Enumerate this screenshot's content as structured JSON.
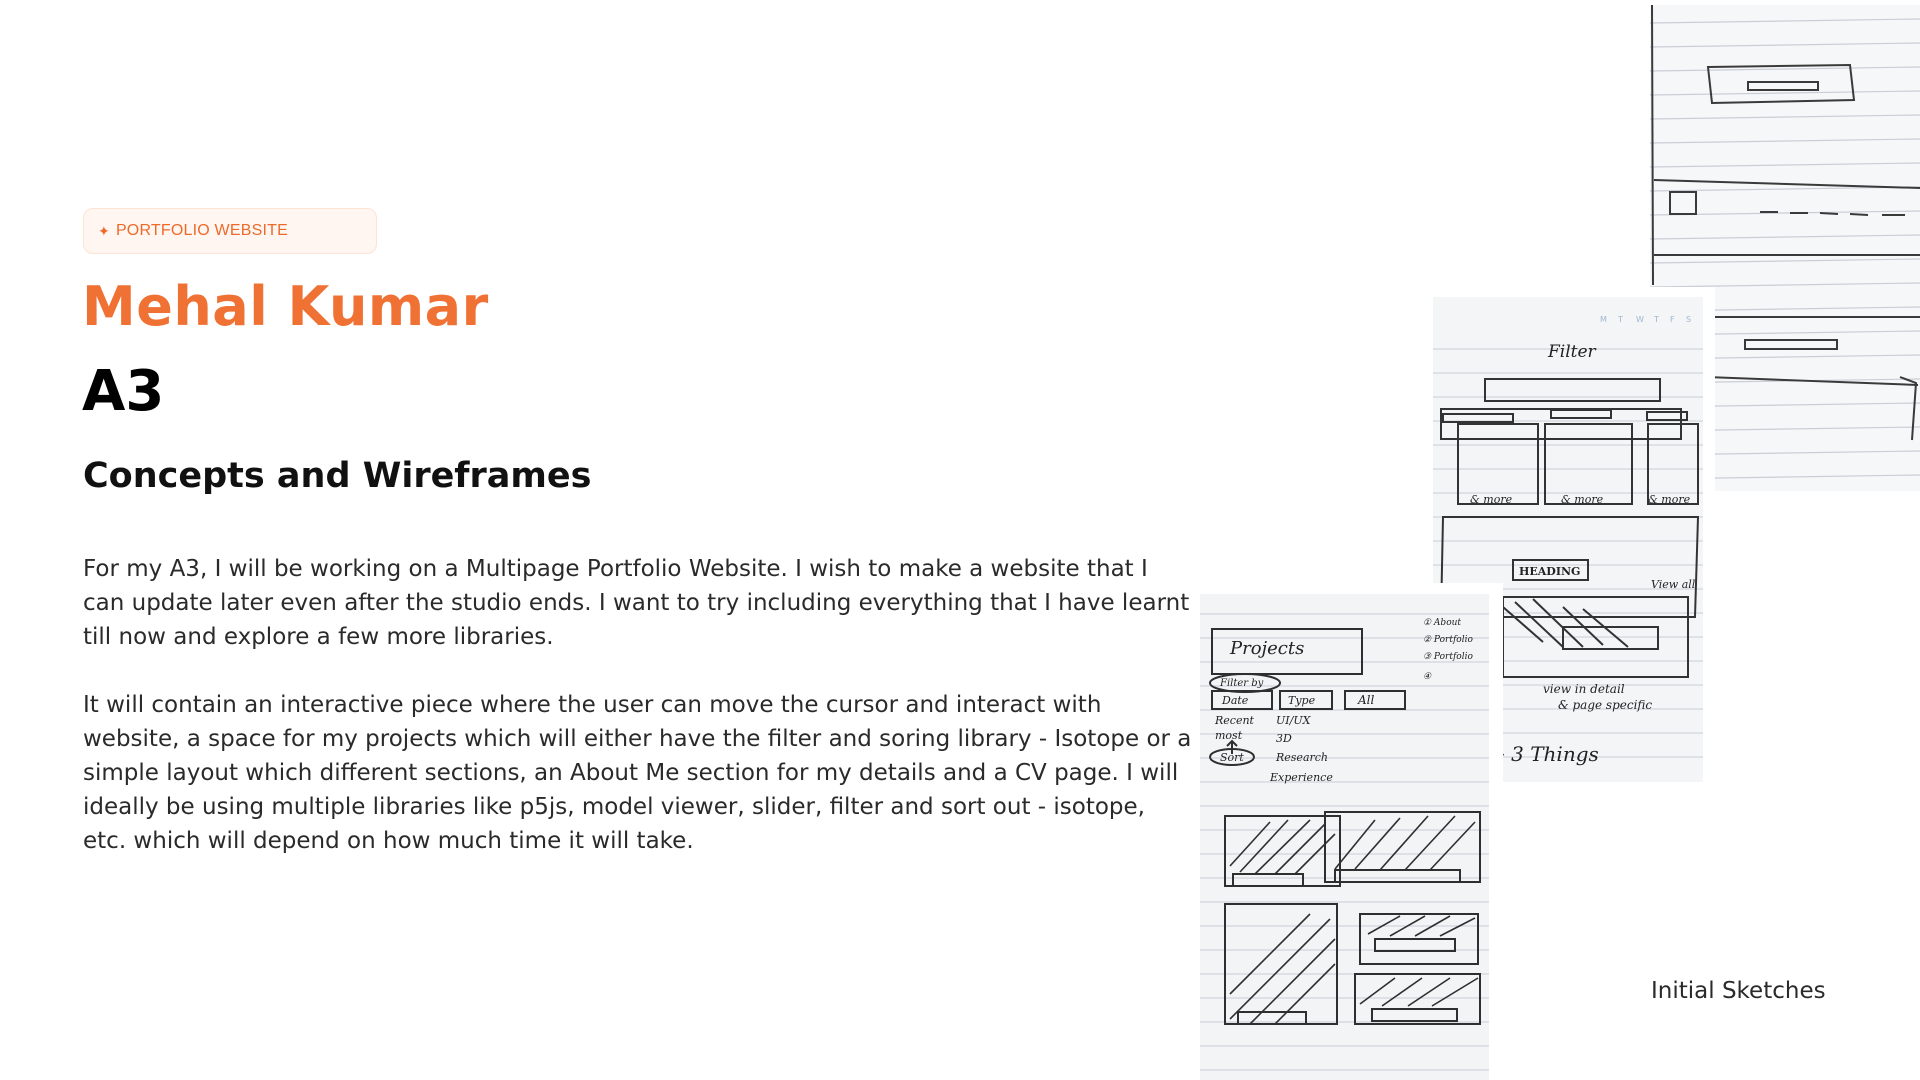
{
  "badge": {
    "icon": "sparkle-icon",
    "label": "PORTFOLIO WEBSITE",
    "color": "#ee6a2a"
  },
  "header": {
    "name": "Mehal Kumar",
    "assignment": "A3",
    "subtitle": "Concepts and Wireframes",
    "accent_color": "#f07134"
  },
  "body": {
    "paragraphs": [
      "For my A3, I will be working on a Multipage Portfolio Website. I wish to make a website that I can update later even after the studio ends. I want to try including everything that I have learnt till now and explore a few more libraries.",
      "It will contain an interactive piece where the user can move the cursor and interact with website, a space for my projects which will either have the filter and soring library - Isotope or a simple layout which different sections, an About Me section for my details and a CV page. I will ideally be using multiple libraries like p5js, model viewer, slider, filter and sort out - isotope, etc. which will depend on how much time it will take."
    ]
  },
  "sketches": {
    "caption": "Initial Sketches",
    "middle": {
      "filter_label": "Filter",
      "more_labels": [
        "& more",
        "& more",
        "& more"
      ],
      "heading_label": "HEADING",
      "view_all_label": "View all",
      "notes": [
        "view in detail",
        "& page specific"
      ],
      "three_things_label": "→ 3 Things",
      "weekday_labels": [
        "M",
        "T",
        "W",
        "T",
        "F",
        "S"
      ]
    },
    "bottom": {
      "projects_label": "Projects",
      "nav_list": [
        "① About",
        "② Portfolio",
        "③ Portfolio",
        "④"
      ],
      "filter_label": "Filter by",
      "filter_buttons": [
        "Date",
        "Type",
        "All"
      ],
      "filter_options": [
        "Recent",
        "most"
      ],
      "type_options": [
        "UI/UX",
        "3D",
        "Research",
        "Experience"
      ],
      "sort_label": "Sort"
    }
  }
}
